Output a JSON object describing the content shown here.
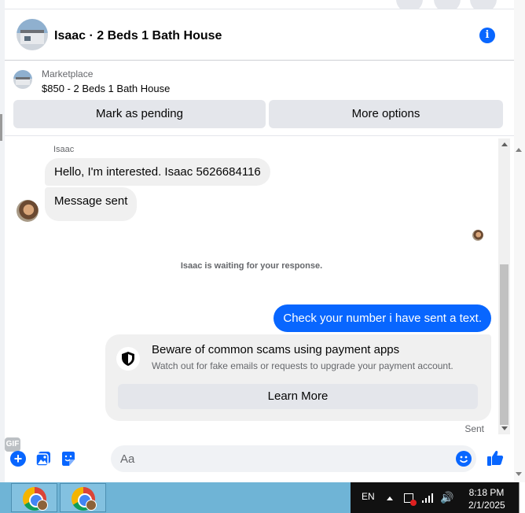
{
  "header": {
    "title": "Isaac · 2 Beds 1 Bath House"
  },
  "listing": {
    "source": "Marketplace",
    "title": "$850 - 2 Beds 1 Bath House",
    "pending_label": "Mark as pending",
    "more_label": "More options"
  },
  "chat": {
    "sender_name": "Isaac",
    "messages_in": [
      "Hello, I'm interested. Isaac 5626684116",
      "Message sent"
    ],
    "waiting_text": "Isaac is waiting for your response.",
    "message_out": "Check your number i have sent a text.",
    "scam_card": {
      "title": "Beware of common scams using payment apps",
      "subtitle": "Watch out for fake emails or requests to upgrade your payment account.",
      "button": "Learn More"
    },
    "status": "Sent"
  },
  "composer": {
    "placeholder": "Aa",
    "gif_label": "GIF"
  },
  "taskbar": {
    "language": "EN",
    "time": "8:18 PM",
    "date": "2/1/2025"
  },
  "colors": {
    "accent": "#0866ff",
    "bubble_gray": "#f0f0f0",
    "taskbar": "#6fb4d6"
  },
  "icons": [
    "info-icon",
    "shield-icon",
    "plus-icon",
    "photo-icon",
    "sticker-icon",
    "gif-icon",
    "emoji-icon",
    "like-icon",
    "chrome-icon",
    "volume-icon",
    "signal-icon"
  ]
}
